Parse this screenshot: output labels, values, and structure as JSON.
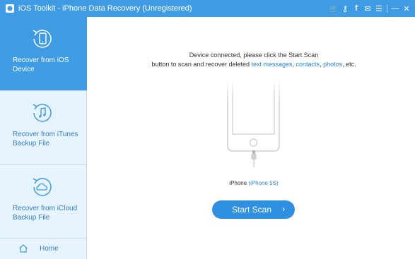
{
  "window": {
    "title": "iOS Toolkit - iPhone Data Recovery (Unregistered)",
    "icons": [
      "cart-icon",
      "key-icon",
      "facebook-icon",
      "chat-icon",
      "menu-icon",
      "minimize-icon",
      "close-icon"
    ],
    "icon_glyphs": {
      "cart": "🛒",
      "key": "⚷",
      "facebook": "f",
      "chat": "✉",
      "menu": "☰",
      "minimize": "—",
      "close": "✕"
    }
  },
  "sidebar": {
    "items": [
      {
        "label": "Recover from iOS Device",
        "icon": "phone-recover-icon",
        "active": true
      },
      {
        "label": "Recover from iTunes Backup File",
        "icon": "itunes-recover-icon",
        "active": false
      },
      {
        "label": "Recover from iCloud Backup File",
        "icon": "icloud-recover-icon",
        "active": false
      }
    ],
    "home_label": "Home"
  },
  "main": {
    "message_line1": "Device connected, please click the Start Scan",
    "message_line2_prefix": "button to scan and recover deleted ",
    "link_messages": "text messages",
    "sep1": ", ",
    "link_contacts": "contacts",
    "sep2": ", ",
    "link_photos": "photos",
    "message_suffix": ", etc.",
    "device_name": "iPhone",
    "device_model": "(iPhone 5S)",
    "scan_button": "Start Scan",
    "scan_chevron": "›"
  },
  "colors": {
    "accent": "#3f9be3",
    "sidebar_bg": "#e7f3fd",
    "link": "#2b86d6"
  }
}
